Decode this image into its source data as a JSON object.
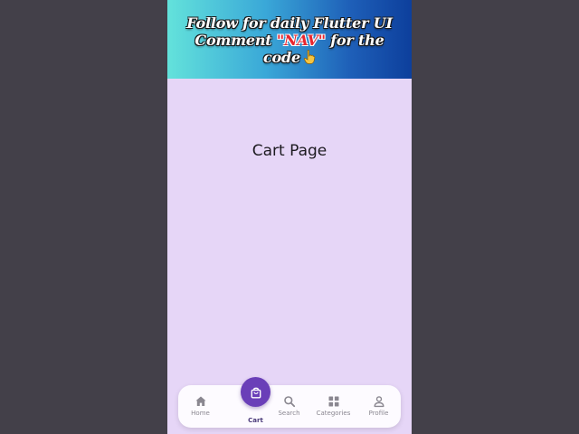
{
  "banner": {
    "line1": "Follow for daily Flutter UI",
    "line2_prefix": "Comment ",
    "line2_keyword": "\"NAV\"",
    "line2_suffix": " for the",
    "line3": "code"
  },
  "page": {
    "title": "Cart Page"
  },
  "nav": {
    "items": [
      {
        "label": "Home",
        "icon": "home-icon"
      },
      {
        "label": "Cart",
        "icon": "shopping-bag-icon",
        "active": true
      },
      {
        "label": "Search",
        "icon": "search-icon"
      },
      {
        "label": "Categories",
        "icon": "grid-icon"
      },
      {
        "label": "Profile",
        "icon": "person-icon"
      }
    ]
  },
  "colors": {
    "background": "#434049",
    "screen": "#e6d6f7",
    "accent": "#6a3fb8",
    "inactive": "#8a8790"
  }
}
